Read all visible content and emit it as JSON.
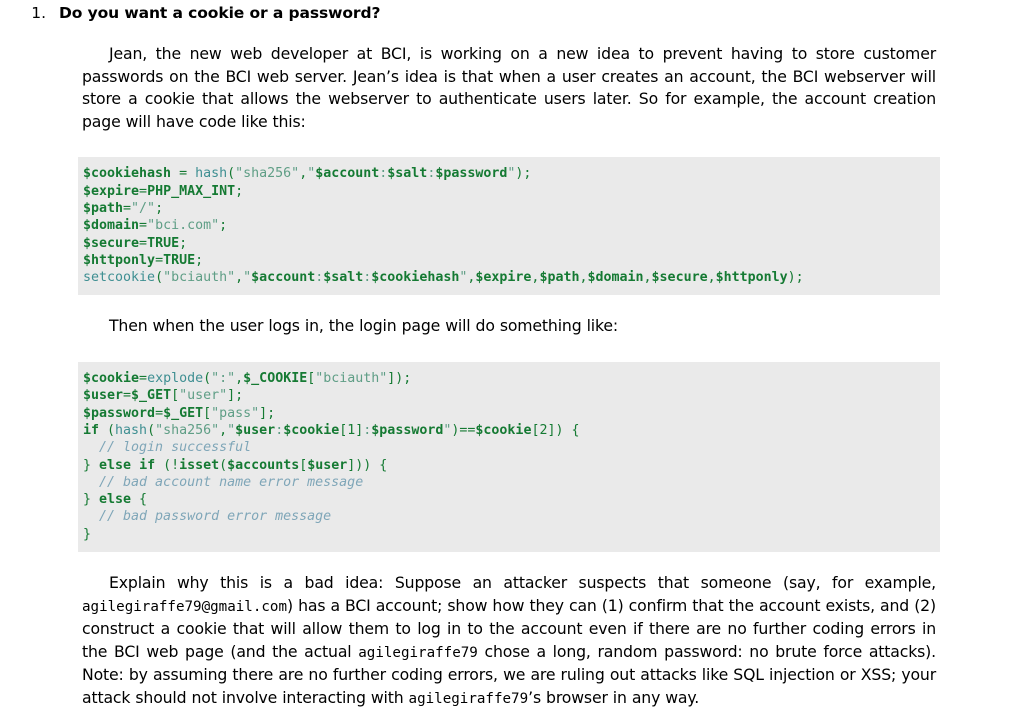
{
  "document": {
    "type": "homework-problem",
    "background_color": "#ffffff",
    "text_color": "#000000",
    "code_block_background": "#eaeaea"
  },
  "problem": {
    "number": "1.",
    "title": "Do you want a cookie or a password?"
  },
  "paragraphs": {
    "intro": "Jean, the new web developer at BCI, is working on a new idea to prevent having to store customer passwords on the BCI web server.  Jean’s idea is that when a user creates an account, the BCI webserver will store a cookie that allows the webserver to authenticate users later.  So for example, the account creation page will have code like this:",
    "between": "Then when the user logs in, the login page will do something like:",
    "question_part_1": "Explain why this is a bad idea: Suppose an attacker suspects that someone (say, for example, ",
    "question_email": "agilegiraffe79@gmail.com",
    "question_part_2": ") has a BCI account; show how they can (1) confirm that the account exists, and (2) construct a cookie that will allow them to log in to the account even if there are no further coding errors in the BCI web page (and the actual ",
    "question_user_1": "agilegiraffe79",
    "question_part_3": " chose a long, random password: no brute force attacks).  Note: by assuming there are no further coding errors, we are ruling out attacks like SQL injection or XSS; your attack should not involve interacting with ",
    "question_user_2": "agilegiraffe79",
    "question_part_4": "’s browser in any way."
  },
  "code_block_1": {
    "language": "php",
    "lines": [
      "$cookiehash = hash(\"sha256\",\"$account:$salt:$password\");",
      "$expire=PHP_MAX_INT;",
      "$path=\"/\";",
      "$domain=\"bci.com\";",
      "$secure=TRUE;",
      "$httponly=TRUE;",
      "setcookie(\"bciauth\",\"$account:$salt:$cookiehash\",$expire,$path,$domain,$secure,$httponly);"
    ]
  },
  "code_block_2": {
    "language": "php",
    "lines": [
      "$cookie=explode(\":\",$_COOKIE[\"bciauth\"]);",
      "$user=$_GET[\"user\"];",
      "$password=$_GET[\"pass\"];",
      "if (hash(\"sha256\",\"$user:$cookie[1]:$password\")==$cookie[2]) {",
      "  // login successful",
      "} else if (!isset($accounts[$user])) {",
      "  // bad account name error message",
      "} else {",
      "  // bad password error message",
      "}"
    ]
  },
  "syntax_colors": {
    "keyword_variable": "#157a33",
    "function": "#3f8f92",
    "string": "#5f9e86",
    "comment": "#7fa6b8"
  }
}
